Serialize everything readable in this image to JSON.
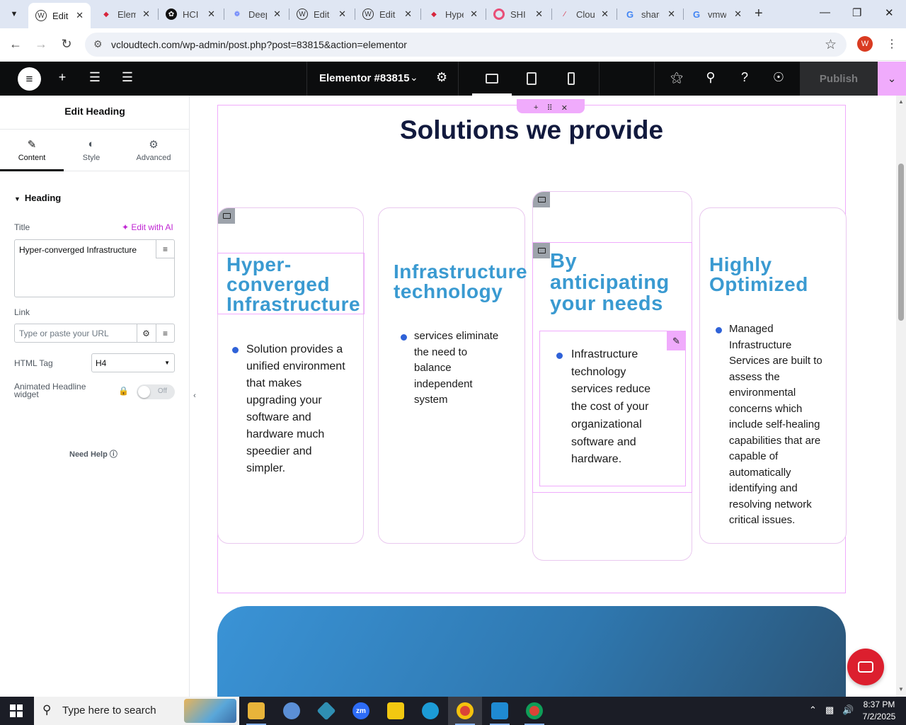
{
  "browser": {
    "tabs": [
      {
        "title": "Edit",
        "favicon": "wordpress-icon",
        "fav_color": "#333333",
        "active": true
      },
      {
        "title": "Elementor",
        "favicon": "elementor-icon",
        "fav_color": "#d7263d",
        "active": false
      },
      {
        "title": "HCI",
        "favicon": "openai-icon",
        "fav_color": "#111111",
        "active": false
      },
      {
        "title": "DeepSeek",
        "favicon": "deepseek-icon",
        "fav_color": "#4d6bfe",
        "active": false
      },
      {
        "title": "Edit",
        "favicon": "wordpress-icon",
        "fav_color": "#333333",
        "active": false
      },
      {
        "title": "Edit",
        "favicon": "wordpress-icon",
        "fav_color": "#333333",
        "active": false
      },
      {
        "title": "Hyper",
        "favicon": "elementor-icon",
        "fav_color": "#d7263d",
        "active": false
      },
      {
        "title": "SHI",
        "favicon": "shi-icon",
        "fav_color": "#e94e77",
        "active": false
      },
      {
        "title": "Cloud",
        "favicon": "cloud-icon",
        "fav_color": "#d7263d",
        "active": false
      },
      {
        "title": "share",
        "favicon": "google-icon",
        "fav_color": "#4285f4",
        "active": false
      },
      {
        "title": "vmw",
        "favicon": "google-icon",
        "fav_color": "#4285f4",
        "active": false
      }
    ],
    "url": "vcloudtech.com/wp-admin/post.php?post=83815&action=elementor",
    "profile_initial": "W"
  },
  "elementor": {
    "document_title": "Elementor #83815",
    "publish_label": "Publish"
  },
  "panel": {
    "title": "Edit Heading",
    "tabs": [
      {
        "label": "Content",
        "icon": "pencil-icon"
      },
      {
        "label": "Style",
        "icon": "half-circle-icon"
      },
      {
        "label": "Advanced",
        "icon": "gear-icon"
      }
    ],
    "section_heading": "Heading",
    "title_label": "Title",
    "edit_with_ai": "Edit with AI",
    "title_value": "Hyper-converged Infrastructure",
    "link_label": "Link",
    "link_placeholder": "Type or paste your URL",
    "html_tag_label": "HTML Tag",
    "html_tag_value": "H4",
    "animated_label": "Animated Headline widget",
    "toggle_state": "Off",
    "need_help": "Need Help"
  },
  "canvas": {
    "section_title": "Solutions we provide",
    "cards": [
      {
        "title": "Hyper-converged Infrastructure",
        "title_lines": [
          "Hyper-",
          "converged",
          "Infrastructure"
        ],
        "text_lines": [
          "Solution provides a",
          "unified environment",
          "that makes",
          "upgrading your",
          "software and",
          "hardware much",
          "speedier and",
          "simpler."
        ]
      },
      {
        "title": "Infrastructure technology",
        "title_lines": [
          "Infrastructure",
          "technology"
        ],
        "text_lines": [
          "services eliminate",
          "the need to",
          "balance",
          "independent",
          "system"
        ]
      },
      {
        "title": "By anticipating your needs",
        "title_lines": [
          "By",
          "anticipating",
          "your needs"
        ],
        "text_lines": [
          "Infrastructure",
          "technology",
          "services reduce",
          "the cost of your",
          "organizational",
          "software and",
          "hardware."
        ]
      },
      {
        "title": "Highly Optimized",
        "title_lines": [
          "Highly",
          "Optimized"
        ],
        "text_lines": [
          "Managed",
          "Infrastructure",
          "Services are built to",
          "assess the",
          "environmental",
          "concerns which",
          "include self-healing",
          "capabilities that are",
          "capable of",
          "automatically",
          "identifying and",
          "resolving network",
          "critical issues."
        ]
      }
    ],
    "colors": {
      "heading": "#121a3e",
      "card_title": "#3a9ad1",
      "bullet": "#2f62d8",
      "accent": "#f0abfc"
    }
  },
  "taskbar": {
    "search_placeholder": "Type here to search",
    "time": "8:37 PM",
    "date": "7/2/2025",
    "apps": [
      {
        "name": "file-explorer",
        "label": "",
        "color": "#e8b43a"
      },
      {
        "name": "paint-app",
        "label": "",
        "color": "#5b8fd6"
      },
      {
        "name": "app-hex",
        "label": "",
        "color": "#2f8fb3"
      },
      {
        "name": "zoom-app",
        "label": "zm",
        "color": "#2d6cf6"
      },
      {
        "name": "sticky-notes",
        "label": "",
        "color": "#f2c811"
      },
      {
        "name": "edge-browser",
        "label": "",
        "color": "#1c9bd6"
      },
      {
        "name": "chrome-browser",
        "label": "",
        "color": "#db4437"
      },
      {
        "name": "vscode",
        "label": "",
        "color": "#1f8ad2"
      },
      {
        "name": "chrome-browser-2",
        "label": "",
        "color": "#db4437"
      }
    ]
  }
}
